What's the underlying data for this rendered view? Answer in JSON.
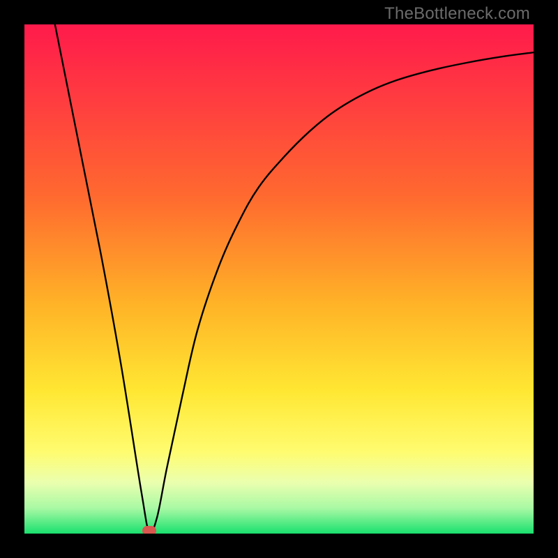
{
  "watermark": "TheBottleneck.com",
  "chart_data": {
    "type": "line",
    "title": "",
    "xlabel": "",
    "ylabel": "",
    "xlim": [
      0,
      100
    ],
    "ylim": [
      0,
      100
    ],
    "grid": false,
    "gradient_stops": [
      {
        "offset": 0,
        "color": "#ff1a4b"
      },
      {
        "offset": 0.16,
        "color": "#ff3f3f"
      },
      {
        "offset": 0.34,
        "color": "#ff6a2f"
      },
      {
        "offset": 0.55,
        "color": "#ffb327"
      },
      {
        "offset": 0.72,
        "color": "#ffe733"
      },
      {
        "offset": 0.84,
        "color": "#fffc70"
      },
      {
        "offset": 0.9,
        "color": "#eaffaf"
      },
      {
        "offset": 0.95,
        "color": "#a9f9a4"
      },
      {
        "offset": 1.0,
        "color": "#19e06e"
      }
    ],
    "series": [
      {
        "name": "bottleneck-curve",
        "x": [
          6,
          10,
          15,
          19,
          23,
          24.5,
          26,
          28,
          31,
          34,
          38,
          42,
          46,
          51,
          56,
          61,
          67,
          73,
          80,
          87,
          94,
          100
        ],
        "y": [
          100,
          80,
          55,
          33,
          8,
          0.5,
          3,
          13,
          27,
          40,
          52,
          61,
          68,
          74,
          79,
          83,
          86.5,
          89,
          91,
          92.5,
          93.7,
          94.5
        ]
      }
    ],
    "marker": {
      "x": 24.5,
      "y": 0.5,
      "color": "#d9574f"
    }
  }
}
